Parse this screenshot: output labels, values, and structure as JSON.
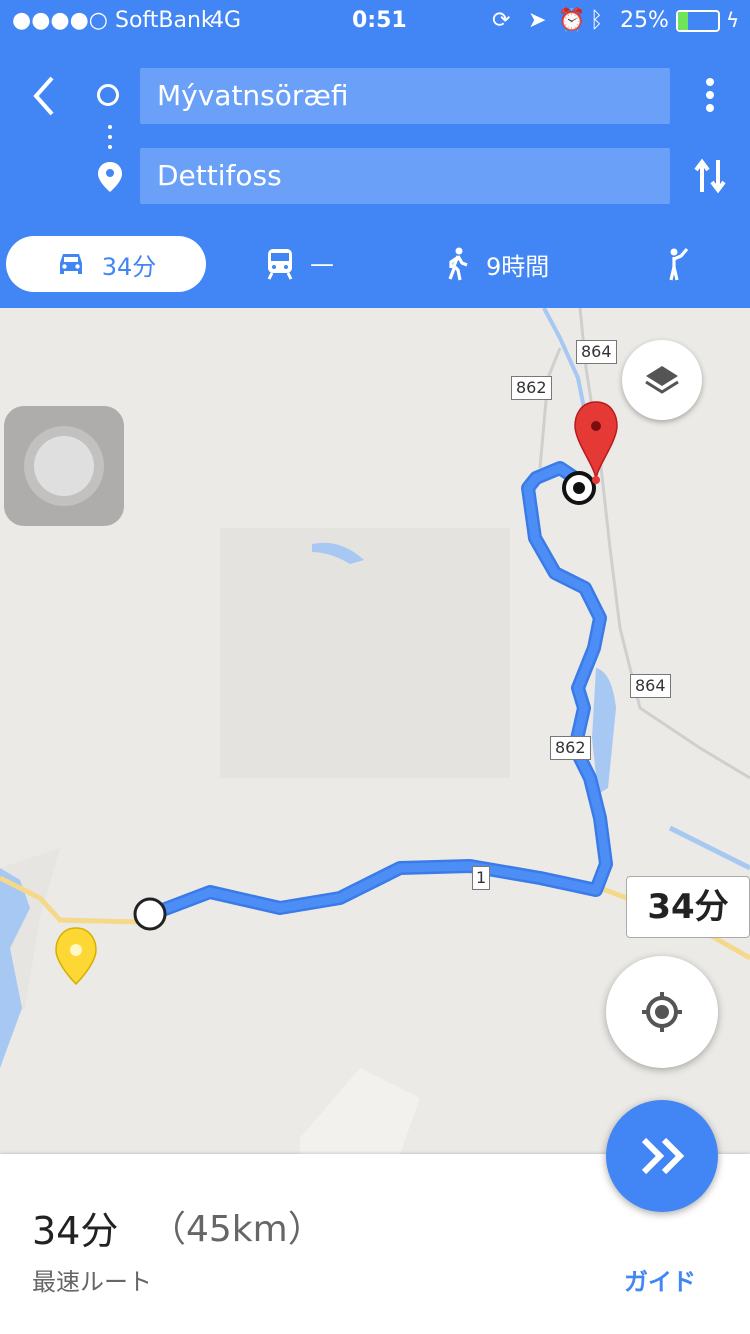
{
  "status": {
    "carrier": "●●●●○ SoftBank",
    "network": "4G",
    "time": "0:51",
    "battery": "25%",
    "battery_level": 0.25
  },
  "route": {
    "origin": "Mývatnsöræfi",
    "destination": "Dettifoss"
  },
  "modes": [
    {
      "name": "car",
      "label": "34分"
    },
    {
      "name": "transit",
      "label": "—"
    },
    {
      "name": "walk",
      "label": "9時間"
    },
    {
      "name": "ride",
      "label": ""
    }
  ],
  "map": {
    "road_labels": [
      "864",
      "862",
      "864",
      "862",
      "1"
    ],
    "eta_bubble": "34分"
  },
  "summary": {
    "time": "34分",
    "distance": "（45km）",
    "subtitle": "最速ルート",
    "guide_label": "ガイド"
  },
  "colors": {
    "accent": "#4285f4",
    "route": "#4285f4",
    "destination_pin": "#e53935",
    "saved_pin": "#fdd835"
  }
}
